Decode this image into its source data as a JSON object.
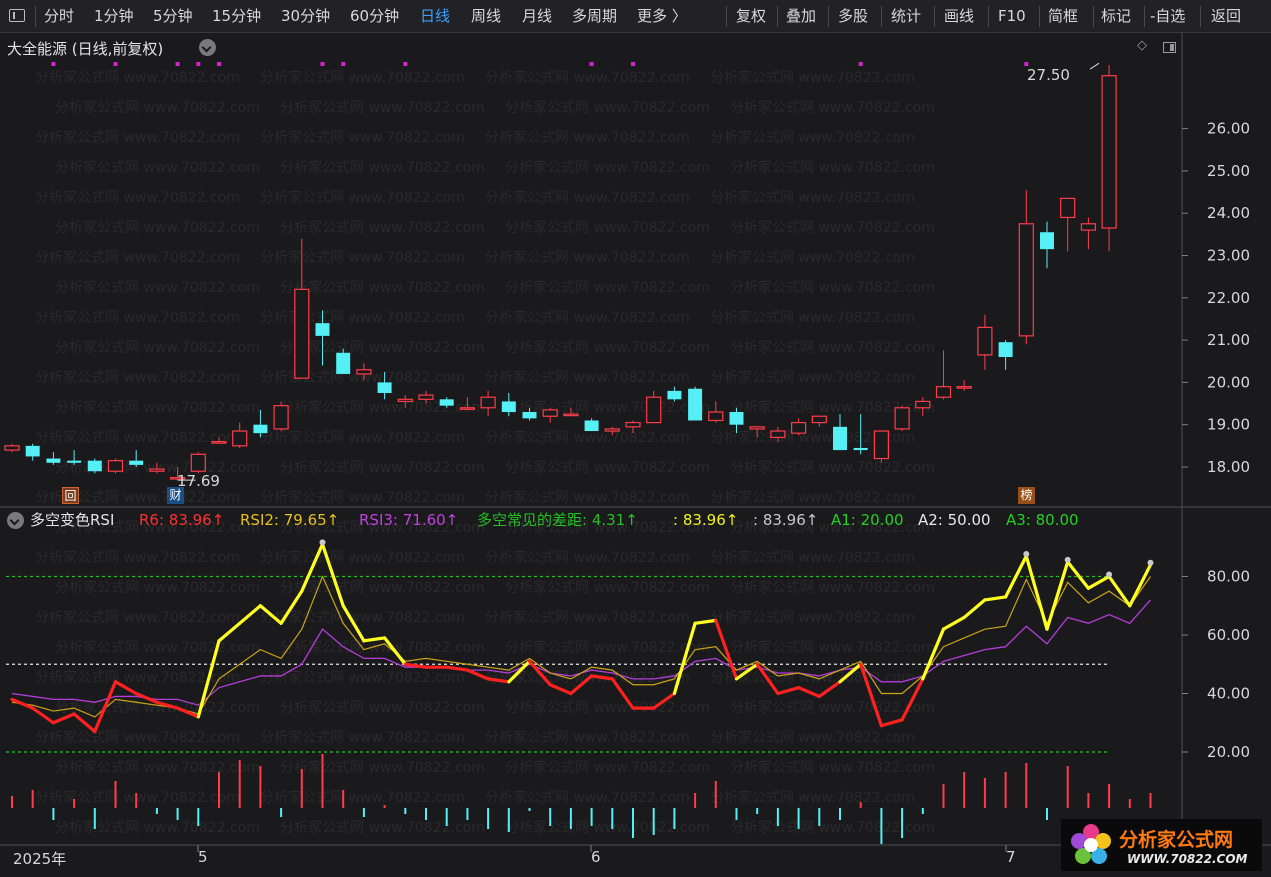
{
  "toolbar": {
    "tabs": [
      "分时",
      "1分钟",
      "5分钟",
      "15分钟",
      "30分钟",
      "60分钟",
      "日线",
      "周线",
      "月线",
      "多周期",
      "更多 〉"
    ],
    "active_tab": "日线",
    "buttons": [
      "复权",
      "叠加",
      "多股",
      "统计",
      "画线",
      "F10",
      "简框",
      "标记",
      "-自选",
      "返回"
    ]
  },
  "price_panel": {
    "title": "大全能源 (日线,前复权)",
    "high_label": "27.50",
    "low_label": "17.69",
    "yaxis": [
      "26.00",
      "25.00",
      "24.00",
      "23.00",
      "22.00",
      "21.00",
      "20.00",
      "19.00",
      "18.00"
    ],
    "markers": [
      "回",
      "财",
      "榜"
    ],
    "watermark": "分析家公式网 www.70822.com",
    "colors": {
      "up": "#ff3c4a",
      "down": "#54f0f6",
      "dot": "#d81fd8"
    }
  },
  "rsi_panel": {
    "name": "多空变色RSI",
    "legend": [
      {
        "text": "R6: 83.96↑",
        "color": "#ff3030"
      },
      {
        "text": "RSI2: 79.65↑",
        "color": "#e8c01a"
      },
      {
        "text": "RSI3: 71.60↑",
        "color": "#c040e0"
      },
      {
        "text": "多空常见的差距: 4.31↑",
        "color": "#22c022"
      },
      {
        "text": ": 83.96↑",
        "color": "#f0f020"
      },
      {
        "text": ": 83.96↑",
        "color": "#c8c8c8"
      },
      {
        "text": "A1: 20.00",
        "color": "#22d022"
      },
      {
        "text": "A2: 50.00",
        "color": "#e8e8e8"
      },
      {
        "text": "A3: 80.00",
        "color": "#22d022"
      }
    ],
    "yaxis": [
      "80.00",
      "60.00",
      "40.00",
      "20.00"
    ]
  },
  "xaxis": {
    "labels": [
      "2025年",
      "5",
      "6",
      "7"
    ]
  },
  "logo": {
    "title": "分析家公式网",
    "url": "WWW.70822.COM"
  },
  "chart_data": {
    "type": "candlestick",
    "candles": [
      {
        "o": 18.4,
        "h": 18.55,
        "l": 18.35,
        "c": 18.5
      },
      {
        "o": 18.5,
        "h": 18.55,
        "l": 18.15,
        "c": 18.25
      },
      {
        "o": 18.2,
        "h": 18.35,
        "l": 18.05,
        "c": 18.1
      },
      {
        "o": 18.15,
        "h": 18.4,
        "l": 18.05,
        "c": 18.1
      },
      {
        "o": 18.15,
        "h": 18.2,
        "l": 17.85,
        "c": 17.9
      },
      {
        "o": 17.9,
        "h": 18.2,
        "l": 17.85,
        "c": 18.15
      },
      {
        "o": 18.15,
        "h": 18.4,
        "l": 18.0,
        "c": 18.05
      },
      {
        "o": 17.9,
        "h": 18.1,
        "l": 17.85,
        "c": 17.95
      },
      {
        "o": 17.72,
        "h": 18.0,
        "l": 17.69,
        "c": 17.75
      },
      {
        "o": 17.9,
        "h": 18.35,
        "l": 17.85,
        "c": 18.3
      },
      {
        "o": 18.6,
        "h": 18.7,
        "l": 18.55,
        "c": 18.6
      },
      {
        "o": 18.5,
        "h": 19.05,
        "l": 18.45,
        "c": 18.85
      },
      {
        "o": 19.0,
        "h": 19.35,
        "l": 18.7,
        "c": 18.8
      },
      {
        "o": 18.9,
        "h": 19.55,
        "l": 18.85,
        "c": 19.45
      },
      {
        "o": 20.1,
        "h": 23.4,
        "l": 20.1,
        "c": 22.2
      },
      {
        "o": 21.4,
        "h": 21.7,
        "l": 20.4,
        "c": 21.1
      },
      {
        "o": 20.7,
        "h": 20.8,
        "l": 20.25,
        "c": 20.2
      },
      {
        "o": 20.2,
        "h": 20.45,
        "l": 20.05,
        "c": 20.3
      },
      {
        "o": 20.0,
        "h": 20.25,
        "l": 19.6,
        "c": 19.75
      },
      {
        "o": 19.55,
        "h": 19.7,
        "l": 19.4,
        "c": 19.6
      },
      {
        "o": 19.6,
        "h": 19.8,
        "l": 19.5,
        "c": 19.7
      },
      {
        "o": 19.6,
        "h": 19.65,
        "l": 19.4,
        "c": 19.45
      },
      {
        "o": 19.4,
        "h": 19.65,
        "l": 19.35,
        "c": 19.4
      },
      {
        "o": 19.4,
        "h": 19.8,
        "l": 19.2,
        "c": 19.65
      },
      {
        "o": 19.55,
        "h": 19.75,
        "l": 19.2,
        "c": 19.3
      },
      {
        "o": 19.3,
        "h": 19.4,
        "l": 19.1,
        "c": 19.15
      },
      {
        "o": 19.2,
        "h": 19.4,
        "l": 19.05,
        "c": 19.35
      },
      {
        "o": 19.25,
        "h": 19.4,
        "l": 19.2,
        "c": 19.25
      },
      {
        "o": 19.1,
        "h": 19.15,
        "l": 18.85,
        "c": 18.85
      },
      {
        "o": 18.85,
        "h": 18.95,
        "l": 18.75,
        "c": 18.9
      },
      {
        "o": 18.95,
        "h": 19.1,
        "l": 18.8,
        "c": 19.05
      },
      {
        "o": 19.05,
        "h": 19.8,
        "l": 19.05,
        "c": 19.65
      },
      {
        "o": 19.8,
        "h": 19.9,
        "l": 19.55,
        "c": 19.6
      },
      {
        "o": 19.85,
        "h": 19.9,
        "l": 19.1,
        "c": 19.1
      },
      {
        "o": 19.1,
        "h": 19.55,
        "l": 19.05,
        "c": 19.3
      },
      {
        "o": 19.3,
        "h": 19.4,
        "l": 18.8,
        "c": 19.0
      },
      {
        "o": 18.9,
        "h": 18.95,
        "l": 18.7,
        "c": 18.95
      },
      {
        "o": 18.7,
        "h": 18.95,
        "l": 18.6,
        "c": 18.85
      },
      {
        "o": 18.8,
        "h": 19.15,
        "l": 18.75,
        "c": 19.05
      },
      {
        "o": 19.05,
        "h": 19.2,
        "l": 18.95,
        "c": 19.2
      },
      {
        "o": 18.95,
        "h": 19.25,
        "l": 18.4,
        "c": 18.4
      },
      {
        "o": 18.45,
        "h": 19.25,
        "l": 18.3,
        "c": 18.4
      },
      {
        "o": 18.2,
        "h": 18.85,
        "l": 18.1,
        "c": 18.85
      },
      {
        "o": 18.9,
        "h": 19.45,
        "l": 18.85,
        "c": 19.4
      },
      {
        "o": 19.4,
        "h": 19.65,
        "l": 19.2,
        "c": 19.55
      },
      {
        "o": 19.65,
        "h": 20.75,
        "l": 19.6,
        "c": 19.9
      },
      {
        "o": 19.9,
        "h": 20.05,
        "l": 19.8,
        "c": 19.9
      },
      {
        "o": 20.65,
        "h": 21.6,
        "l": 20.3,
        "c": 21.3
      },
      {
        "o": 20.95,
        "h": 21.0,
        "l": 20.3,
        "c": 20.6
      },
      {
        "o": 21.1,
        "h": 24.55,
        "l": 20.9,
        "c": 23.75
      },
      {
        "o": 23.55,
        "h": 23.8,
        "l": 22.7,
        "c": 23.15
      },
      {
        "o": 23.9,
        "h": 24.35,
        "l": 23.1,
        "c": 24.35
      },
      {
        "o": 23.6,
        "h": 23.9,
        "l": 23.15,
        "c": 23.75
      },
      {
        "o": 23.65,
        "h": 27.5,
        "l": 23.1,
        "c": 27.25
      }
    ],
    "rsi": {
      "A1": 20,
      "A2": 50,
      "A3": 80,
      "R6": [
        38,
        35,
        30,
        33,
        27,
        44,
        40,
        37,
        35,
        32,
        58,
        64,
        70,
        64,
        75,
        91,
        70,
        58,
        59,
        50,
        49,
        49,
        48,
        45,
        44,
        51,
        43,
        40,
        46,
        45,
        35,
        35,
        40,
        64,
        65,
        45,
        50,
        40,
        42,
        39,
        44,
        50,
        29,
        31,
        45,
        62,
        66,
        72,
        73,
        87,
        62,
        85,
        76,
        80,
        70,
        84
      ],
      "RSI2": [
        37,
        36,
        34,
        35,
        32,
        38,
        37,
        36,
        35,
        33,
        45,
        50,
        55,
        52,
        62,
        80,
        64,
        55,
        57,
        51,
        52,
        51,
        50,
        49,
        48,
        52,
        47,
        45,
        49,
        48,
        43,
        43,
        45,
        55,
        56,
        48,
        51,
        46,
        47,
        45,
        48,
        51,
        40,
        40,
        46,
        56,
        59,
        62,
        63,
        79,
        64,
        78,
        71,
        75,
        70,
        80
      ],
      "RSI3": [
        40,
        39,
        38,
        38,
        37,
        39,
        39,
        38,
        38,
        36,
        42,
        44,
        46,
        46,
        50,
        62,
        56,
        52,
        52,
        49,
        49,
        49,
        48,
        48,
        47,
        50,
        47,
        46,
        48,
        47,
        45,
        45,
        46,
        51,
        52,
        48,
        49,
        47,
        47,
        46,
        48,
        49,
        44,
        44,
        46,
        51,
        53,
        55,
        56,
        63,
        57,
        66,
        64,
        67,
        64,
        72
      ],
      "histogram": [
        4,
        6,
        -4,
        3,
        -7,
        9,
        5,
        -2,
        -4,
        -6,
        12,
        16,
        14,
        -3,
        13,
        18,
        6,
        -3,
        1,
        -2,
        -4,
        -6,
        -4,
        -7,
        -8,
        -1,
        -6,
        -7,
        -6,
        -7,
        -10,
        -9,
        -7,
        5,
        9,
        -4,
        -2,
        -6,
        -7,
        -6,
        -4,
        2,
        -12,
        -10,
        -2,
        8,
        12,
        10,
        12,
        15,
        -4,
        14,
        5,
        8,
        3,
        5
      ]
    }
  }
}
